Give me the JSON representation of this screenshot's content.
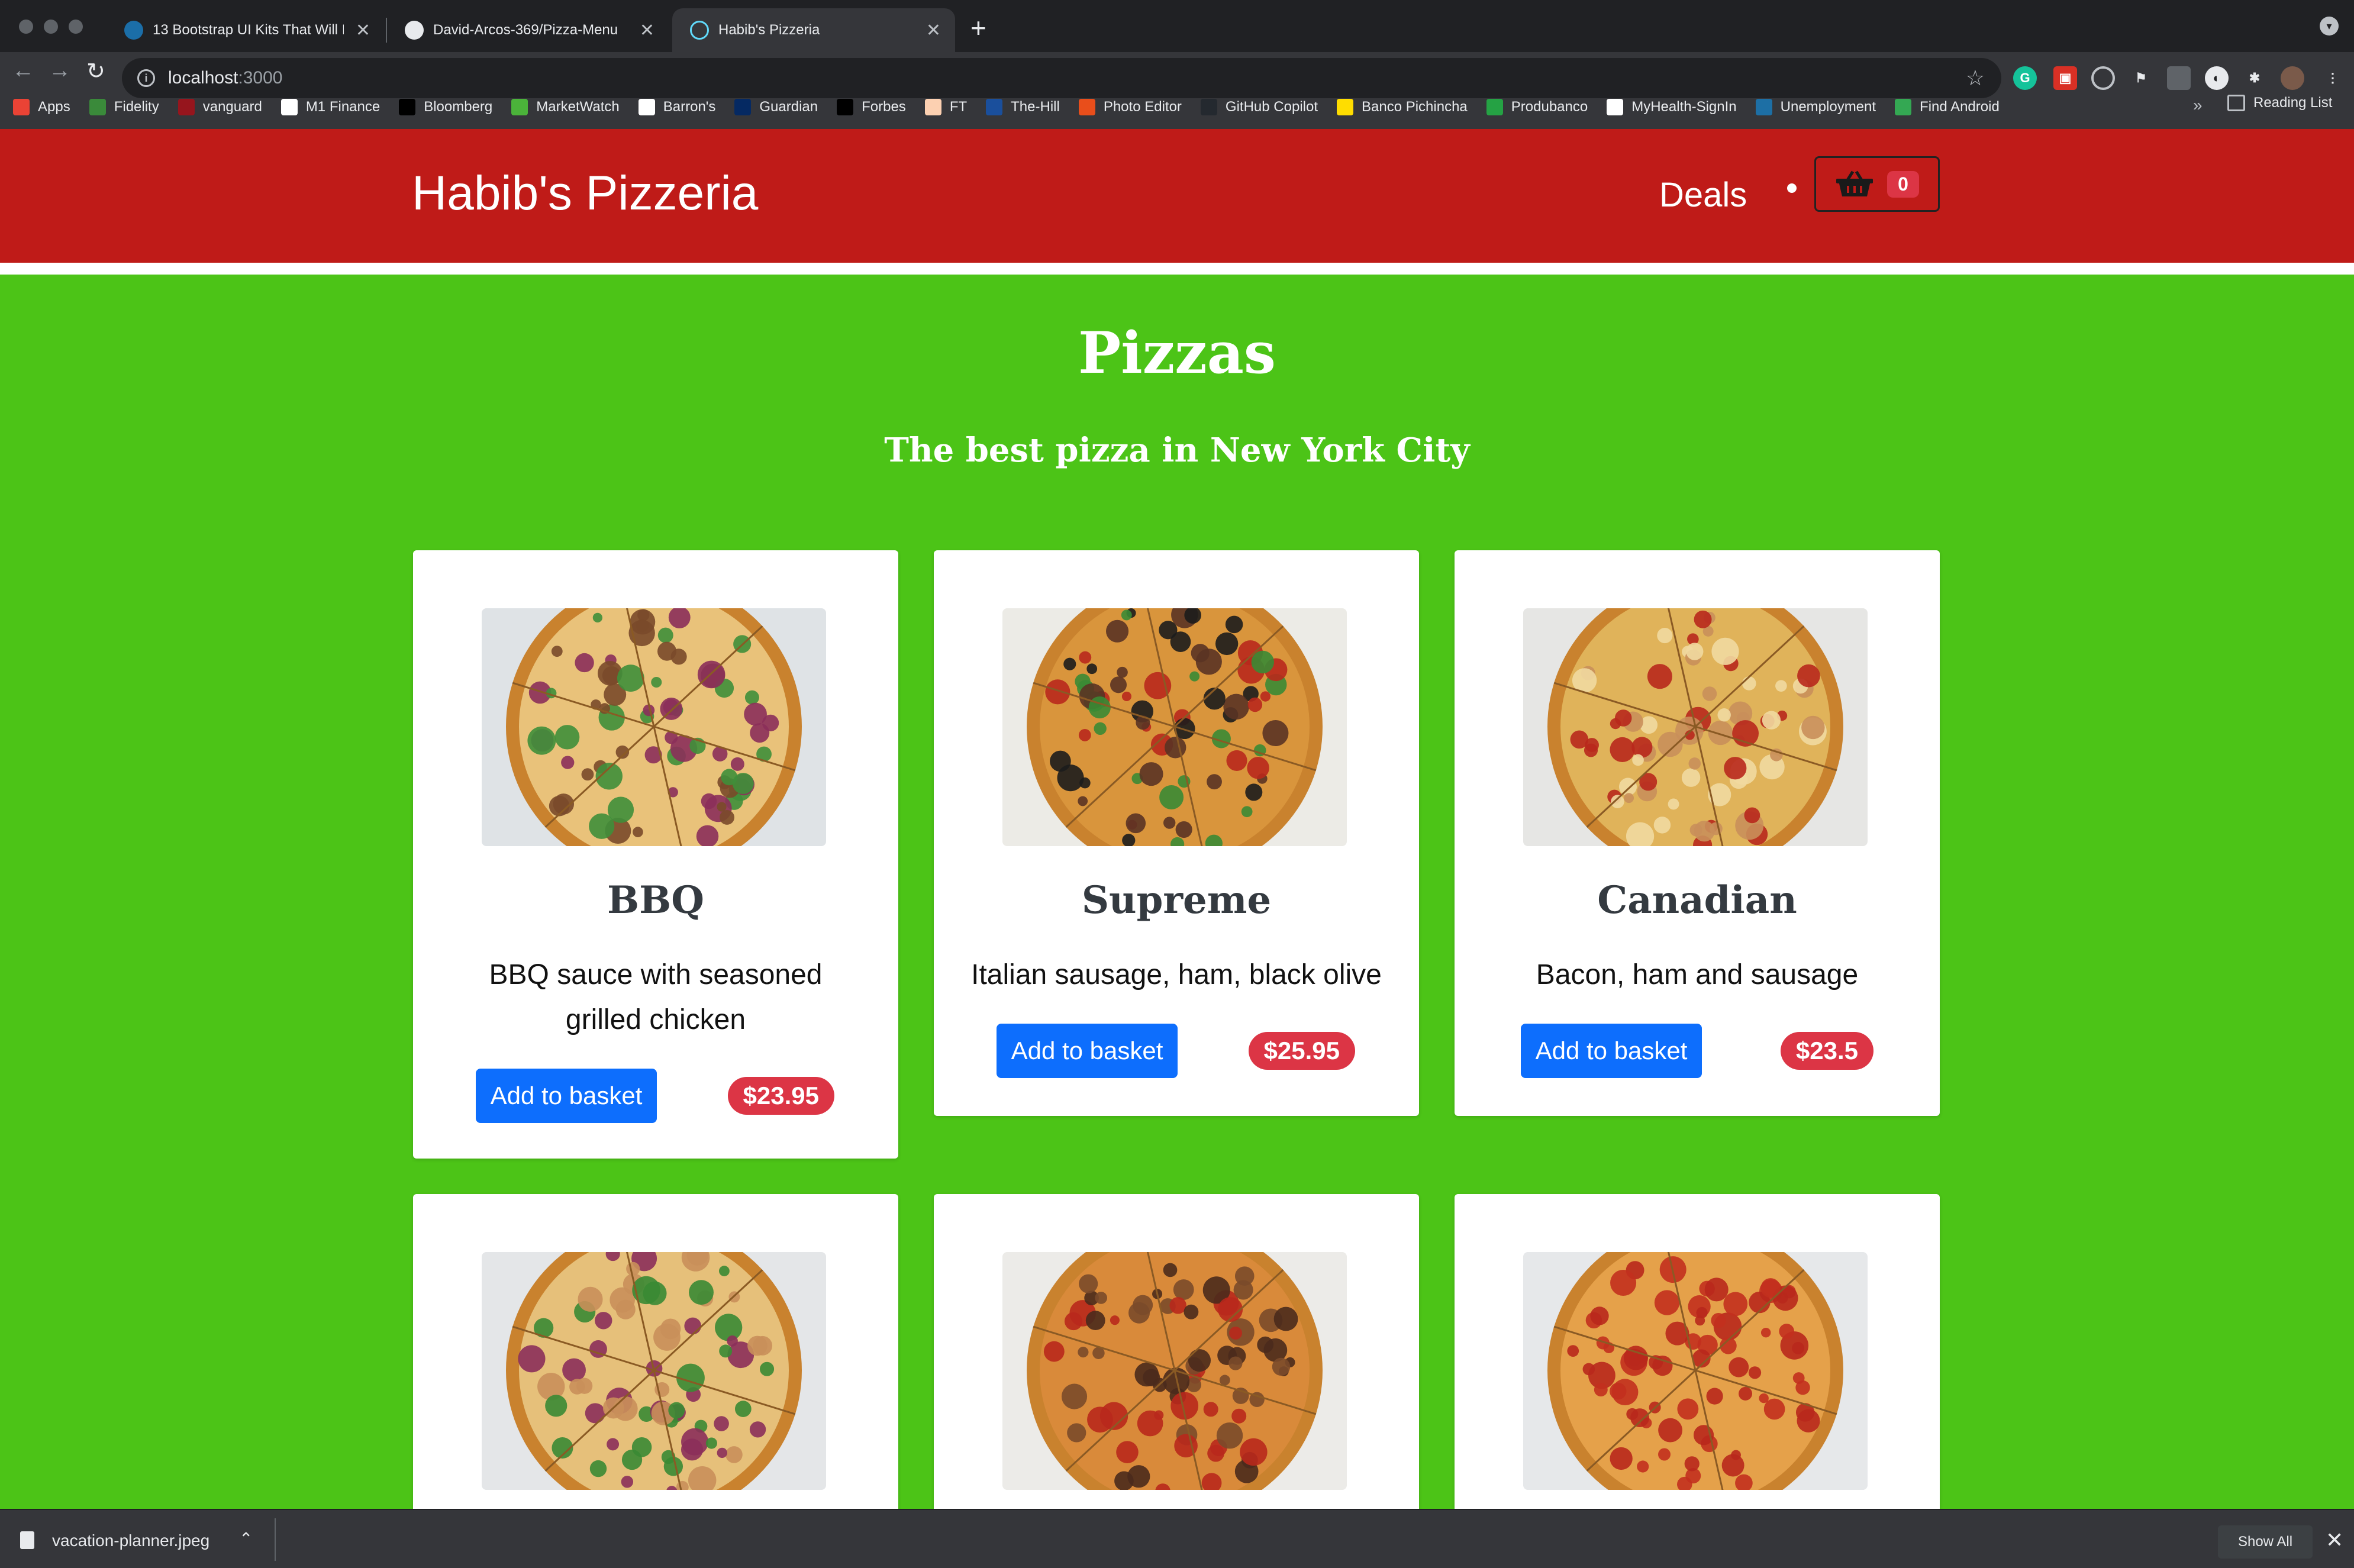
{
  "browser": {
    "tabs": [
      {
        "title": "13 Bootstrap UI Kits That Will I",
        "icon": "bootstrap-icon",
        "active": false
      },
      {
        "title": "David-Arcos-369/Pizza-Menu",
        "icon": "github-icon",
        "active": false
      },
      {
        "title": "Habib's Pizzeria",
        "icon": "react-icon",
        "active": true
      }
    ],
    "url_host": "localhost",
    "url_port": ":3000",
    "bookmarks": [
      {
        "label": "Apps",
        "icon": "apps-grid-icon",
        "color": "#ea4335"
      },
      {
        "label": "Fidelity",
        "icon": "fidelity-icon",
        "color": "#3a8a3a"
      },
      {
        "label": "vanguard",
        "icon": "vanguard-icon",
        "color": "#96151d"
      },
      {
        "label": "M1 Finance",
        "icon": "m1-icon",
        "color": "#ffffff"
      },
      {
        "label": "Bloomberg",
        "icon": "bloomberg-icon",
        "color": "#000000"
      },
      {
        "label": "MarketWatch",
        "icon": "marketwatch-icon",
        "color": "#4bb33a"
      },
      {
        "label": "Barron's",
        "icon": "barrons-icon",
        "color": "#ffffff"
      },
      {
        "label": "Guardian",
        "icon": "guardian-icon",
        "color": "#052962"
      },
      {
        "label": "Forbes",
        "icon": "forbes-icon",
        "color": "#000000"
      },
      {
        "label": "FT",
        "icon": "ft-icon",
        "color": "#fcd0b1"
      },
      {
        "label": "The-Hill",
        "icon": "the-hill-icon",
        "color": "#1a4f9c"
      },
      {
        "label": "Photo Editor",
        "icon": "photo-editor-icon",
        "color": "#e94e1b"
      },
      {
        "label": "GitHub Copilot",
        "icon": "github-copilot-icon",
        "color": "#24292f"
      },
      {
        "label": "Banco Pichincha",
        "icon": "banco-pichincha-icon",
        "color": "#ffdd00"
      },
      {
        "label": "Produbanco",
        "icon": "produbanco-icon",
        "color": "#25a244"
      },
      {
        "label": "MyHealth-SignIn",
        "icon": "myhealth-icon",
        "color": "#ffffff"
      },
      {
        "label": "Unemployment",
        "icon": "unemployment-icon",
        "color": "#1d6fa5"
      },
      {
        "label": "Find Android",
        "icon": "find-android-icon",
        "color": "#34a853"
      }
    ],
    "more_bookmarks": "»",
    "reading_list": "Reading List",
    "download": {
      "filename": "vacation-planner.jpeg",
      "show_all": "Show All"
    }
  },
  "navbar": {
    "brand": "Habib's Pizzeria",
    "deals": "Deals",
    "basket_count": "0",
    "color": "#bf1b18"
  },
  "main": {
    "heading": "Pizzas",
    "subheading": "The best pizza in New York City",
    "background": "#4cc417"
  },
  "pizzas": [
    {
      "name": "BBQ",
      "description": "BBQ sauce with seasoned grilled chicken",
      "price": "$23.95",
      "button": "Add to basket",
      "topping": "bbq"
    },
    {
      "name": "Supreme",
      "description": "Italian sausage, ham, black olive",
      "price": "$25.95",
      "button": "Add to basket",
      "topping": "supreme"
    },
    {
      "name": "Canadian",
      "description": "Bacon, ham and sausage",
      "price": "$23.5",
      "button": "Add to basket",
      "topping": "canadian"
    },
    {
      "name": "",
      "description": "",
      "price": "",
      "button": "",
      "topping": "veggie"
    },
    {
      "name": "",
      "description": "",
      "price": "",
      "button": "",
      "topping": "meat"
    },
    {
      "name": "",
      "description": "",
      "price": "",
      "button": "",
      "topping": "pepperoni"
    }
  ]
}
